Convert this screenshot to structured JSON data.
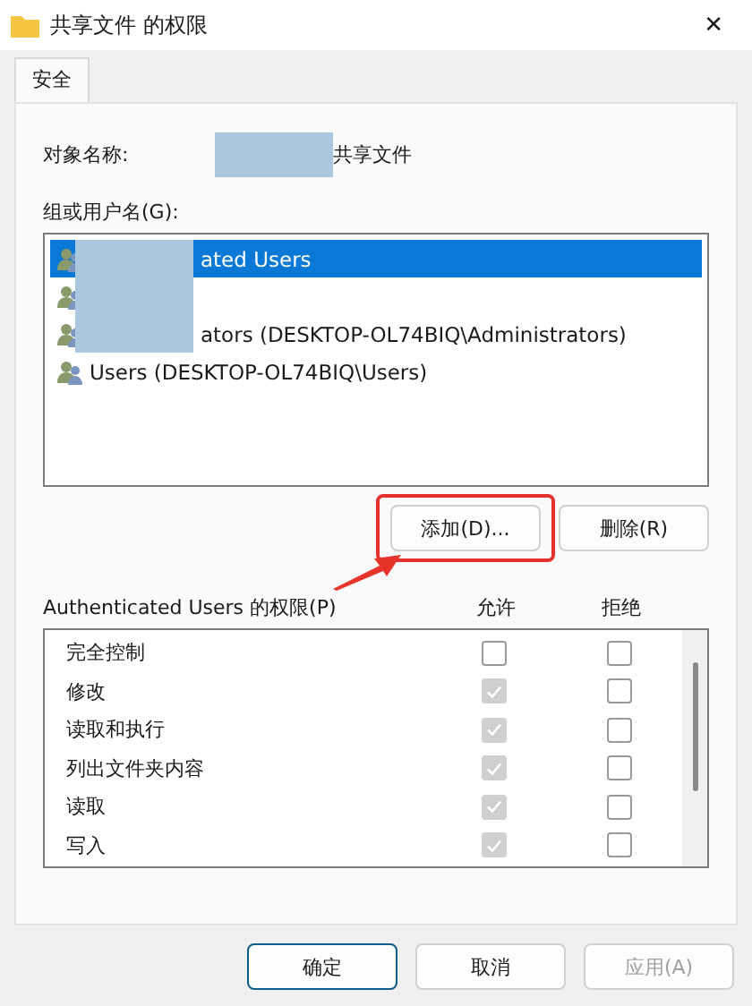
{
  "window": {
    "title": "共享文件 的权限",
    "close": "✕"
  },
  "tabs": [
    {
      "label": "安全",
      "selected": true
    }
  ],
  "object_name": {
    "label": "对象名称:",
    "value": "共享文件"
  },
  "groups": {
    "label": "组或用户名(G):",
    "items": [
      {
        "name": "ated Users",
        "selected": true,
        "redacted": true
      },
      {
        "selected": false,
        "redacted": true
      },
      {
        "name": "ators (DESKTOP-OL74BIQ\\Administrators)",
        "selected": false,
        "redacted": true
      },
      {
        "name": "Users (DESKTOP-OL74BIQ\\Users)",
        "selected": false,
        "redacted": false
      }
    ]
  },
  "group_buttons": [
    {
      "label": "添加(D)...",
      "highlighted": true
    },
    {
      "label": "删除(R)",
      "highlighted": false
    }
  ],
  "permissions": {
    "label": "Authenticated Users 的权限(P)",
    "allow_header": "允许",
    "deny_header": "拒绝",
    "rows": [
      {
        "name": "完全控制",
        "allow": false,
        "allow_disabled": false,
        "deny": false
      },
      {
        "name": "修改",
        "allow": true,
        "allow_disabled": true,
        "deny": false
      },
      {
        "name": "读取和执行",
        "allow": true,
        "allow_disabled": true,
        "deny": false
      },
      {
        "name": "列出文件夹内容",
        "allow": true,
        "allow_disabled": true,
        "deny": false
      },
      {
        "name": "读取",
        "allow": true,
        "allow_disabled": true,
        "deny": false
      },
      {
        "name": "写入",
        "allow": true,
        "allow_disabled": true,
        "deny": false
      }
    ]
  },
  "buttons": [
    {
      "label": "确定",
      "default": true,
      "disabled": false
    },
    {
      "label": "取消",
      "default": false,
      "disabled": false
    },
    {
      "label": "应用(A)",
      "default": false,
      "disabled": true
    }
  ]
}
